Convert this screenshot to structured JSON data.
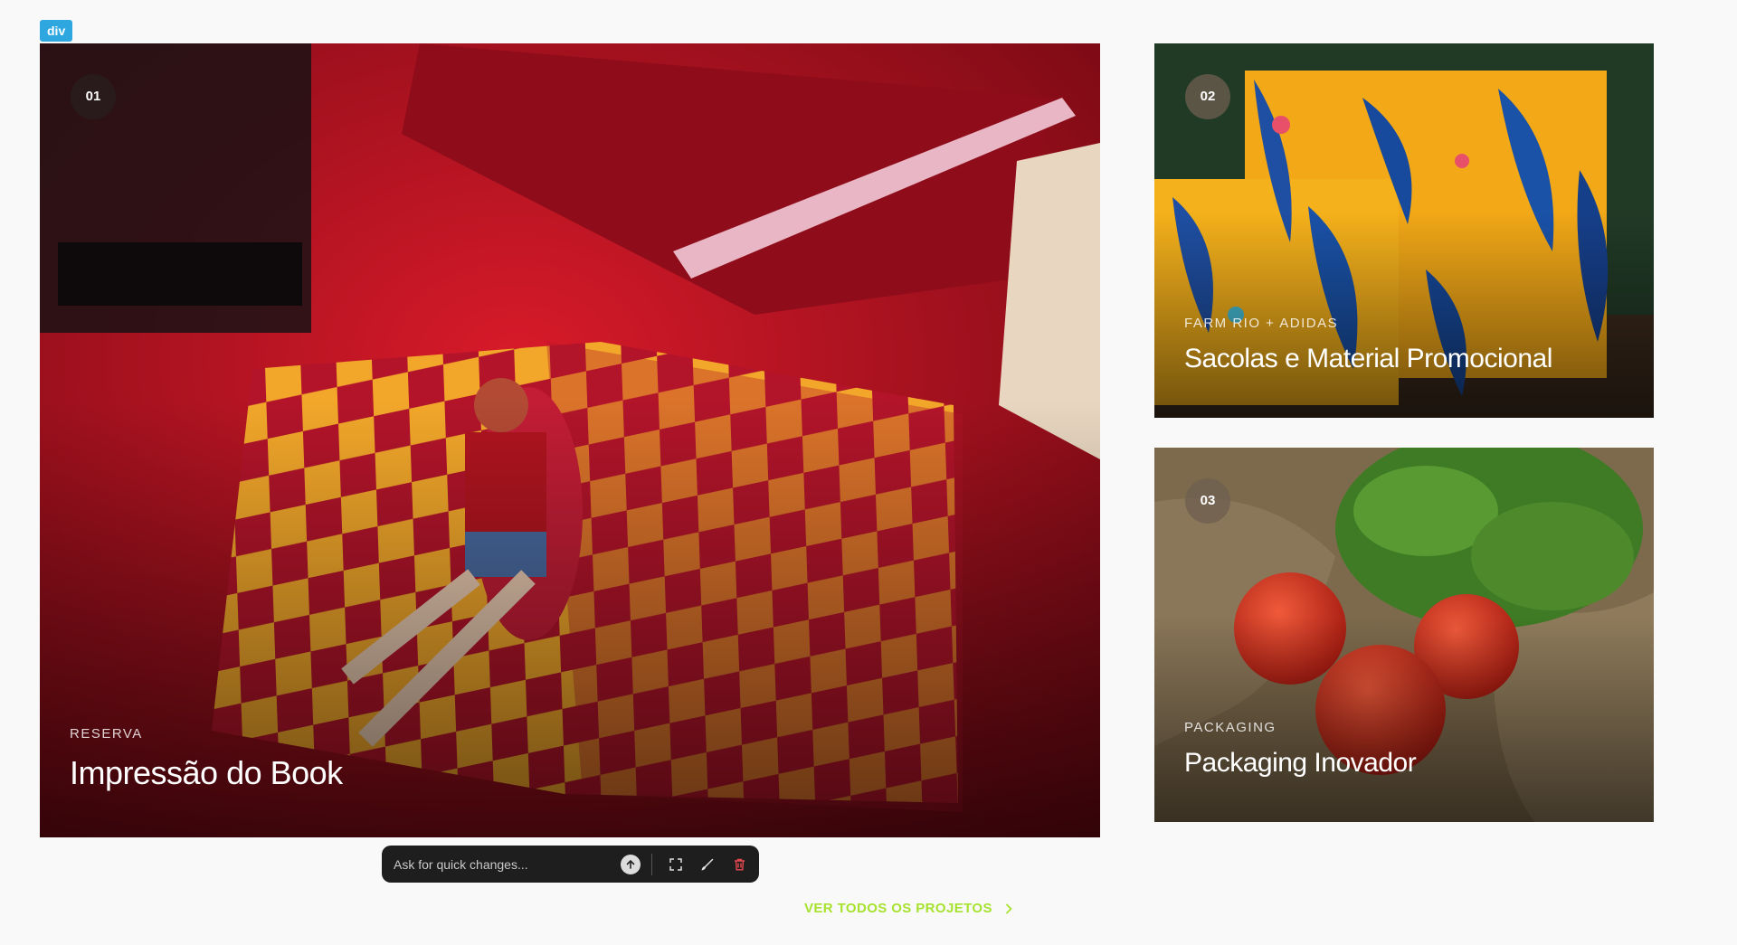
{
  "inspector": {
    "tag": "div"
  },
  "projects": [
    {
      "number": "01",
      "client": "RESERVA",
      "title": "Impressão do Book"
    },
    {
      "number": "02",
      "client": "FARM RIO + ADIDAS",
      "title": "Sacolas e Material Promocional"
    },
    {
      "number": "03",
      "client": "PACKAGING",
      "title": "Packaging Inovador"
    }
  ],
  "toolbar": {
    "placeholder": "Ask for quick changes...",
    "icons": [
      "send-arrow-up-icon",
      "fullscreen-icon",
      "brush-icon",
      "trash-icon"
    ]
  },
  "cta": {
    "label": "VER TODOS OS PROJETOS",
    "icon": "chevron-right-icon"
  },
  "colors": {
    "accent": "#a7e22e",
    "delete": "#e5484d",
    "card1_base": "#a3101d"
  }
}
